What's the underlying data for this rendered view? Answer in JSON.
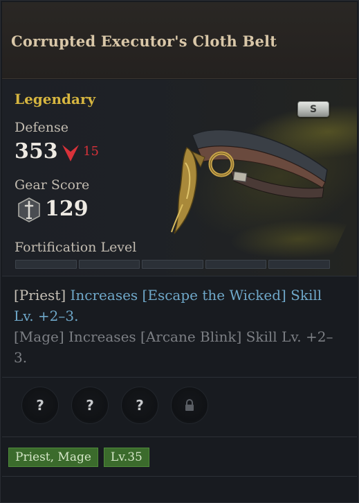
{
  "item": {
    "name": "Corrupted Executor's Cloth Belt",
    "grade": "Legendary",
    "rank_badge": "S"
  },
  "stats": {
    "defense_label": "Defense",
    "defense_value": "353",
    "defense_diff": "15",
    "gear_score_label": "Gear Score",
    "gear_score_value": "129",
    "fortification_label": "Fortification Level",
    "fortification_segments_total": 5,
    "fortification_segments_filled": 0
  },
  "description": {
    "priest_prefix": "[Priest]",
    "priest_effect": "Increases [Escape the Wicked] Skill Lv. +2–3.",
    "mage_line": "[Mage] Increases [Arcane Blink] Skill Lv. +2–3."
  },
  "sockets": [
    {
      "symbol": "?",
      "icon": "question-icon"
    },
    {
      "symbol": "?",
      "icon": "question-icon"
    },
    {
      "symbol": "?",
      "icon": "question-icon"
    },
    {
      "symbol": "🔒",
      "icon": "lock-icon"
    }
  ],
  "tags": {
    "classes": "Priest, Mage",
    "level": "Lv.35"
  },
  "colors": {
    "grade": "#d7b640",
    "highlight": "#6fa8c9",
    "decrease": "#d9323a",
    "tag_green": "#3b6b2c"
  }
}
